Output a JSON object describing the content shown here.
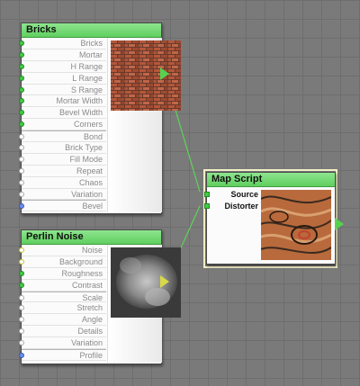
{
  "nodes": {
    "bricks": {
      "title": "Bricks",
      "ports": [
        "Bricks",
        "Mortar",
        "H Range",
        "L Range",
        "S Range",
        "Mortar Width",
        "Bevel Width",
        "Corners",
        "Bond",
        "Brick Type",
        "Fill Mode",
        "Repeat",
        "Chaos",
        "Variation",
        "Bevel"
      ]
    },
    "perlin": {
      "title": "Perlin Noise",
      "ports": [
        "Noise",
        "Background",
        "Roughness",
        "Contrast",
        "Scale",
        "Stretch",
        "Angle",
        "Details",
        "Variation",
        "Profile"
      ]
    },
    "map_script": {
      "title": "Map Script",
      "ports": [
        "Source",
        "Distorter"
      ]
    }
  },
  "colors": {
    "header": "#6fd86f",
    "wire": "#5ed35a",
    "canvas": "#7a7a7a"
  }
}
